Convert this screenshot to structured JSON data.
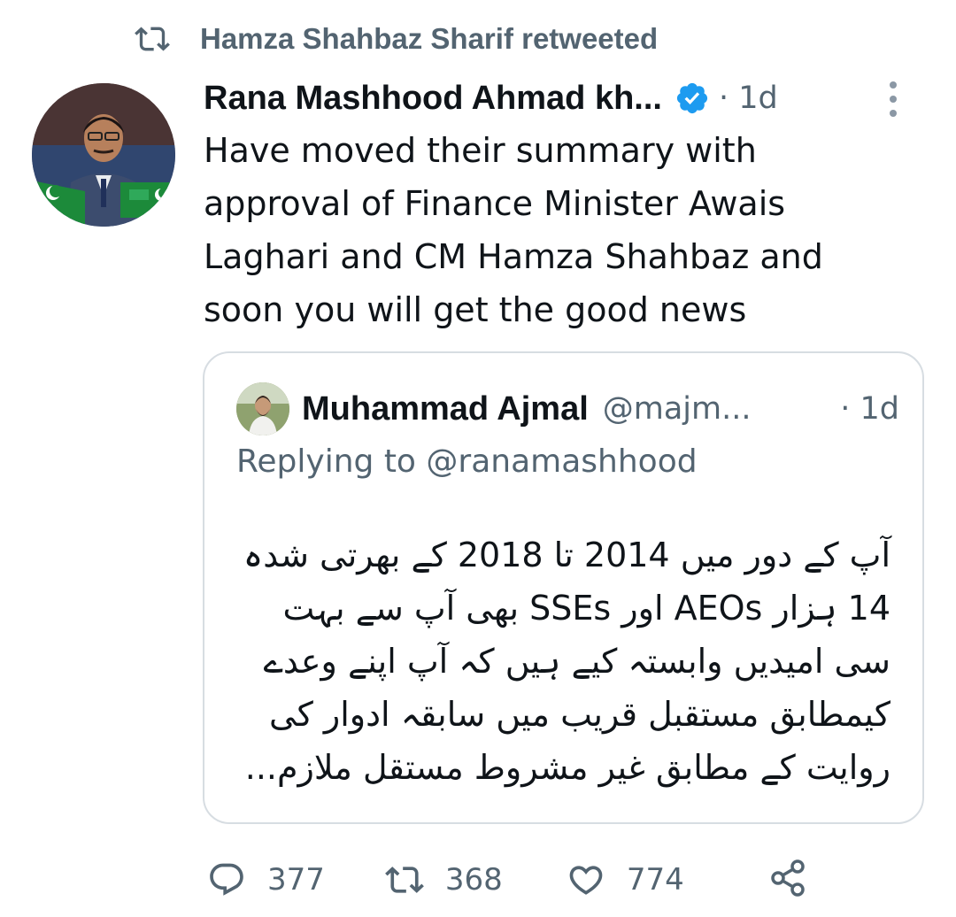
{
  "retweet_context": {
    "icon": "retweet-icon",
    "text": "Hamza Shahbaz Sharif retweeted"
  },
  "tweet": {
    "author_name": "Rana Mashhood Ahmad kh...",
    "verified_icon": "verified-badge-icon",
    "time": "· 1d",
    "more_icon": "more-vertical-icon",
    "text": "Have moved their summary with approval of Finance Minister Awais Laghari and CM Hamza Shahbaz and soon you will get the good news"
  },
  "quoted": {
    "author_name": "Muhammad Ajmal",
    "handle": "@majm...",
    "time": "· 1d",
    "replying_label": "Replying to ",
    "replying_mention": "@ranamashhood",
    "text": "آپ کے دور میں 2014 تا 2018 کے بھرتی شدہ 14 ہزار AEOs اور SSEs بھی آپ سے بہت سی امیدیں وابستہ کیے ہیں کہ آپ اپنے وعدے کیمطابق مستقبل قریب میں سابقہ ادوار کی روایت کے مطابق غیر مشروط مستقل ملازم..."
  },
  "actions": {
    "reply_count": "377",
    "retweet_count": "368",
    "like_count": "774"
  },
  "colors": {
    "accent": "#1d9bf0",
    "muted": "#536471",
    "border": "#d7dde2",
    "text": "#0f1419"
  }
}
